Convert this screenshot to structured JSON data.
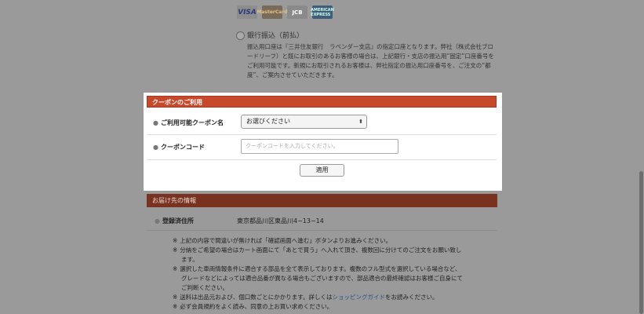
{
  "payment": {
    "cards": [
      {
        "icon": "visa-card-icon",
        "label": "VISA"
      },
      {
        "icon": "mastercard-icon",
        "label": "MasterCard"
      },
      {
        "icon": "jcb-card-icon",
        "label": "JCB"
      },
      {
        "icon": "amex-card-icon",
        "label": "AMERICAN EXPRESS"
      }
    ],
    "bank_transfer": {
      "label": "銀行振込（前払）",
      "description": "振込用口座は『三井住友銀行　ラベンダー支店』の指定口座となります。弊社（株式会社ブロードリーフ）と既にお取引のあるお客様の場合は、上記銀行・支店の振込用”固定”口座番号をご利用可能です。新規にお取引されるお客様は、弊社指定の振込用口座番号を、ご注文の”都度”、ご案内させていただきます。"
    }
  },
  "coupon": {
    "title": "クーポンのご利用",
    "available_label": "ご利用可能クーポン名",
    "select_value": "お選びください",
    "code_label": "クーポンコード",
    "code_placeholder": "クーポンコードを入力してください。",
    "apply_label": "適用",
    "bullet": "●"
  },
  "delivery": {
    "title": "お届け先の情報",
    "registered_label": "登録済住所",
    "registered_value": "東京都品川区東品川4−13−14",
    "notes": [
      {
        "mark": "※",
        "text": "上記の内容で間違いが無ければ「確認画面へ進む」ボタンよりお進みください。"
      },
      {
        "mark": "※",
        "text": "分納をご希望の場合はカート画面にて「あとで買う」へ入れて頂き、複数回に分けてのご注文をお願い致します。"
      },
      {
        "mark": "※",
        "text": "選択した車両情報条件に適合する部品を全て表示しております。複数のフル型式を選択している場合など、グレードなどによっては適合品番が異なる場合もございますので、部品適合の最終確認はお客様ご自身にてご判断ください。"
      },
      {
        "mark": "※",
        "text_before": "送料は出品元および、個口数ごとにかかります。詳しくは",
        "link": "ショッピングガイド",
        "text_after": "をお読みください。"
      },
      {
        "mark": "※",
        "text": "必ず会員規約をよく読み、同意の上お買い求めください。"
      }
    ]
  },
  "colors": {
    "accent": "#c8482c",
    "link": "#2b4f88"
  }
}
